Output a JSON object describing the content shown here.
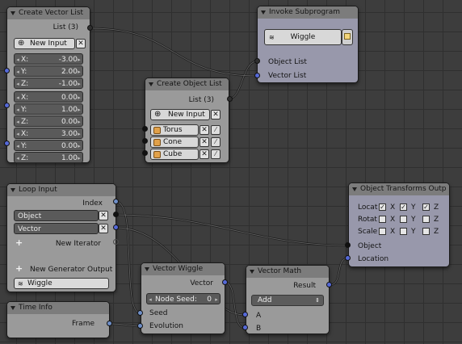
{
  "nodes": {
    "create_vector_list": {
      "title": "Create Vector List",
      "output": "List (3)",
      "new_input": "New Input",
      "vectors": [
        {
          "x": "-3.00",
          "y": "2.00",
          "z": "-1.00"
        },
        {
          "x": "0.00",
          "y": "1.00",
          "z": "0.00"
        },
        {
          "x": "3.00",
          "y": "0.00",
          "z": "1.00"
        }
      ],
      "axis": {
        "x": "X:",
        "y": "Y:",
        "z": "Z:"
      }
    },
    "invoke_subprogram": {
      "title": "Invoke Subprogram",
      "program": "Wiggle",
      "inputs": [
        "Object List",
        "Vector List"
      ]
    },
    "create_object_list": {
      "title": "Create Object List",
      "output": "List (3)",
      "new_input": "New Input",
      "objects": [
        "Torus",
        "Cone",
        "Cube"
      ]
    },
    "loop_input": {
      "title": "Loop Input",
      "index": "Index",
      "params": [
        "Object",
        "Vector"
      ],
      "new_iterator": "New Iterator",
      "new_generator": "New Generator Output",
      "loop_name": "Wiggle"
    },
    "object_transforms": {
      "title": "Object Transforms Outp",
      "rows": [
        {
          "label": "Locat",
          "checks": [
            true,
            true,
            true
          ]
        },
        {
          "label": "Rotat",
          "checks": [
            false,
            false,
            false
          ]
        },
        {
          "label": "Scale",
          "checks": [
            false,
            false,
            false
          ]
        }
      ],
      "axes": [
        "X",
        "Y",
        "Z"
      ],
      "inputs": [
        "Object",
        "Location"
      ]
    },
    "vector_wiggle": {
      "title": "Vector Wiggle",
      "output": "Vector",
      "seed_label": "Node Seed:",
      "seed_value": "0",
      "inputs": [
        "Seed",
        "Evolution"
      ]
    },
    "vector_math": {
      "title": "Vector Math",
      "output": "Result",
      "operation": "Add",
      "inputs": [
        "A",
        "B"
      ]
    },
    "time_info": {
      "title": "Time Info",
      "output": "Frame"
    }
  },
  "colors": {
    "background": "#3d3d3d",
    "node_body": "#9a9a9a",
    "node_body_violet": "#9898ab",
    "node_header": "#7c7c7c",
    "vector_socket": "#5569d8",
    "object_socket": "#111111",
    "link": "#1c1c1c"
  }
}
